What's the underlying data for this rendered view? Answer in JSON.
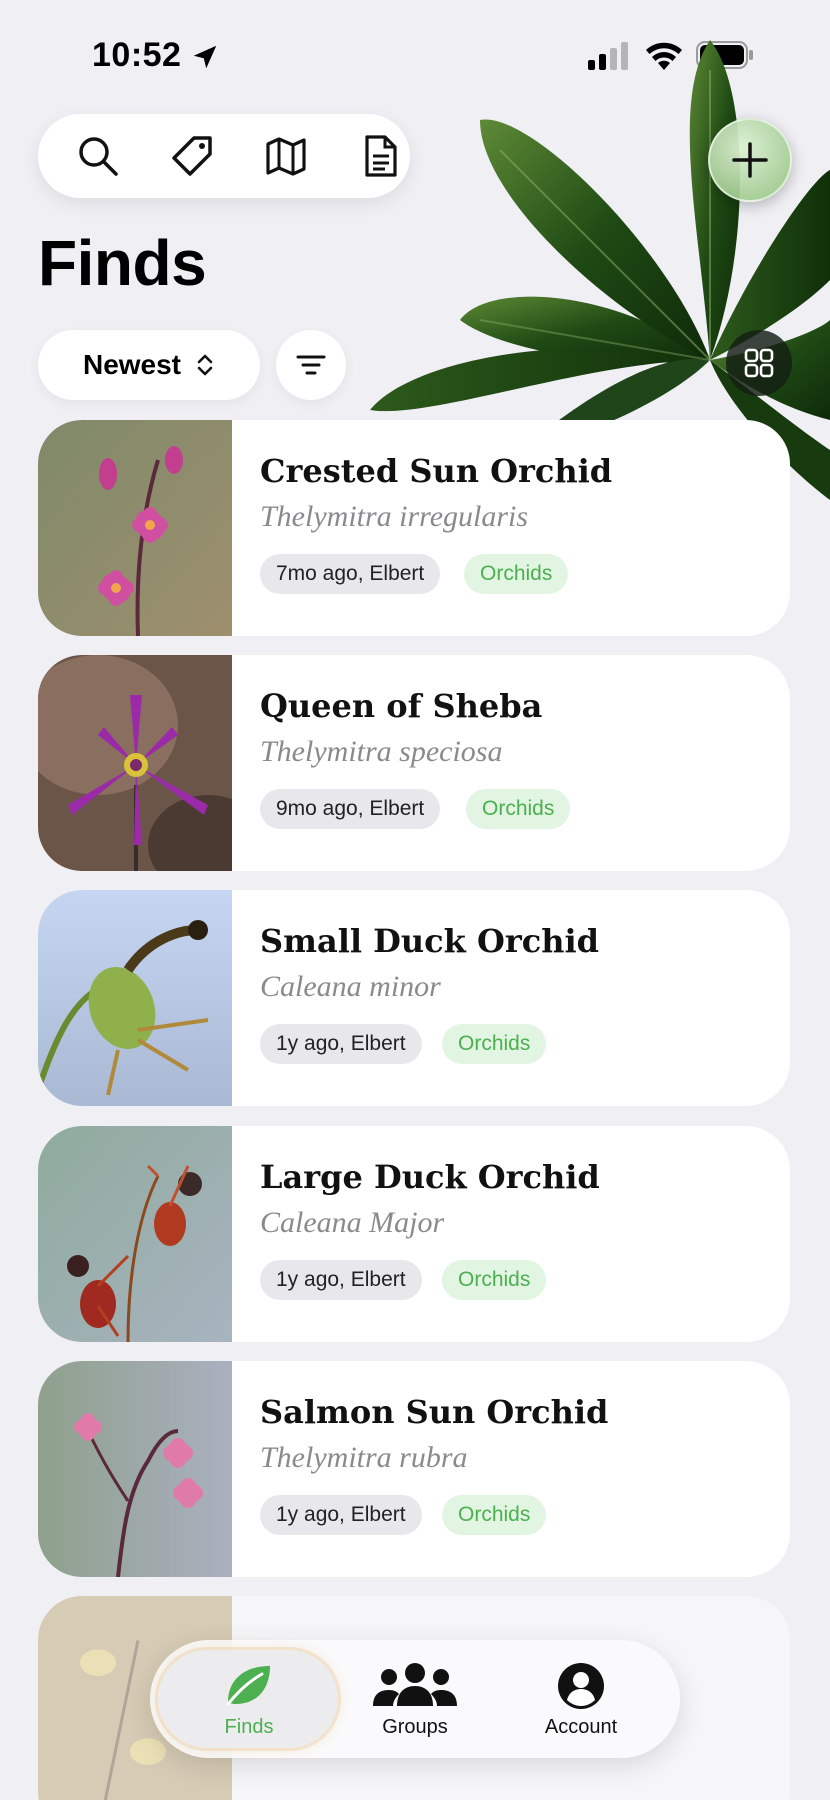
{
  "status_bar": {
    "time": "10:52",
    "icons": [
      "location-arrow-icon",
      "cellular-signal-icon",
      "wifi-icon",
      "battery-icon"
    ]
  },
  "toolbar": {
    "buttons": [
      {
        "icon": "search-icon"
      },
      {
        "icon": "tag-icon"
      },
      {
        "icon": "map-icon"
      },
      {
        "icon": "document-icon"
      }
    ],
    "add_icon": "plus-icon"
  },
  "page": {
    "title": "Finds"
  },
  "controls": {
    "sort_label": "Newest",
    "sort_icon": "chevron-up-down-icon",
    "filter_icon": "filter-lines-icon",
    "view_icon": "grid-icon"
  },
  "finds": [
    {
      "common_name": "Crested Sun Orchid",
      "scientific_name": "Thelymitra irregularis",
      "meta": "7mo ago, Elbert",
      "tag": "Orchids"
    },
    {
      "common_name": "Queen of Sheba",
      "scientific_name": "Thelymitra speciosa",
      "meta": "9mo ago, Elbert",
      "tag": "Orchids"
    },
    {
      "common_name": "Small Duck Orchid",
      "scientific_name": "Caleana minor",
      "meta": "1y ago, Elbert",
      "tag": "Orchids"
    },
    {
      "common_name": "Large Duck Orchid",
      "scientific_name": "Caleana Major",
      "meta": "1y ago, Elbert",
      "tag": "Orchids"
    },
    {
      "common_name": "Salmon Sun Orchid",
      "scientific_name": "Thelymitra rubra",
      "meta": "1y ago, Elbert",
      "tag": "Orchids"
    }
  ],
  "tabbar": {
    "tabs": [
      {
        "label": "Finds",
        "icon": "leaf-icon",
        "active": true
      },
      {
        "label": "Groups",
        "icon": "people-icon",
        "active": false
      },
      {
        "label": "Account",
        "icon": "person-circle-icon",
        "active": false
      }
    ]
  },
  "colors": {
    "background": "#efeff4",
    "accent_green": "#4caf50",
    "tag_bg": "#e2f5e2",
    "meta_chip_bg": "#e8e8ec"
  }
}
